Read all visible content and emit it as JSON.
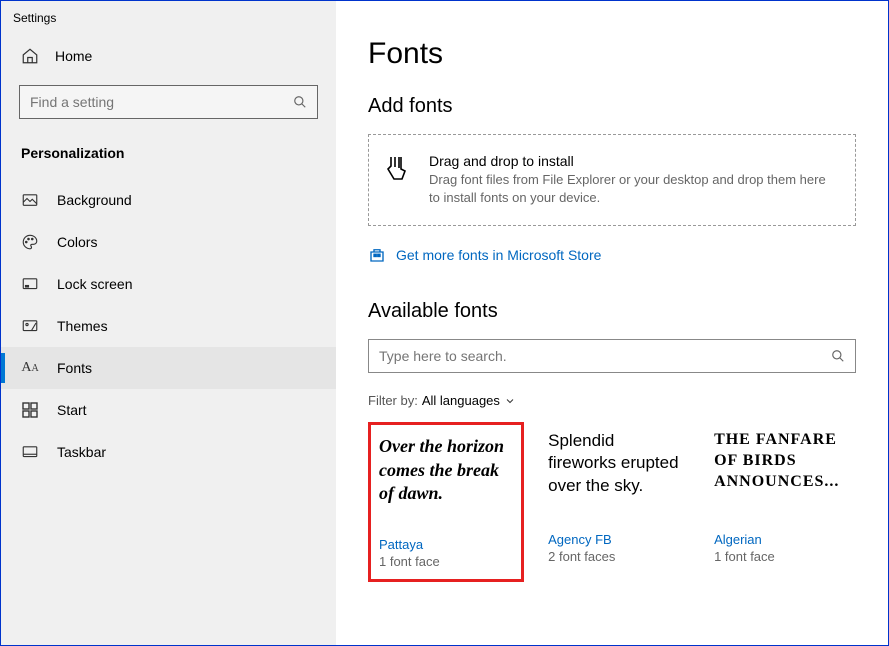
{
  "window_title": "Settings",
  "sidebar": {
    "home_label": "Home",
    "search_placeholder": "Find a setting",
    "section_label": "Personalization",
    "items": [
      {
        "label": "Background"
      },
      {
        "label": "Colors"
      },
      {
        "label": "Lock screen"
      },
      {
        "label": "Themes"
      },
      {
        "label": "Fonts"
      },
      {
        "label": "Start"
      },
      {
        "label": "Taskbar"
      }
    ]
  },
  "main": {
    "title": "Fonts",
    "add_fonts_label": "Add fonts",
    "dropzone_title": "Drag and drop to install",
    "dropzone_sub": "Drag font files from File Explorer or your desktop and drop them here to install fonts on your device.",
    "store_link": "Get more fonts in Microsoft Store",
    "available_label": "Available fonts",
    "font_search_placeholder": "Type here to search.",
    "filter_label": "Filter by:",
    "filter_value": "All languages",
    "fonts": [
      {
        "preview": "Over the horizon comes the break of dawn.",
        "name": "Pattaya",
        "faces": "1 font face"
      },
      {
        "preview": "Splendid fireworks erupted over the sky.",
        "name": "Agency FB",
        "faces": "2 font faces"
      },
      {
        "preview": "The fanfare of birds announces...",
        "name": "Algerian",
        "faces": "1 font face"
      }
    ]
  }
}
